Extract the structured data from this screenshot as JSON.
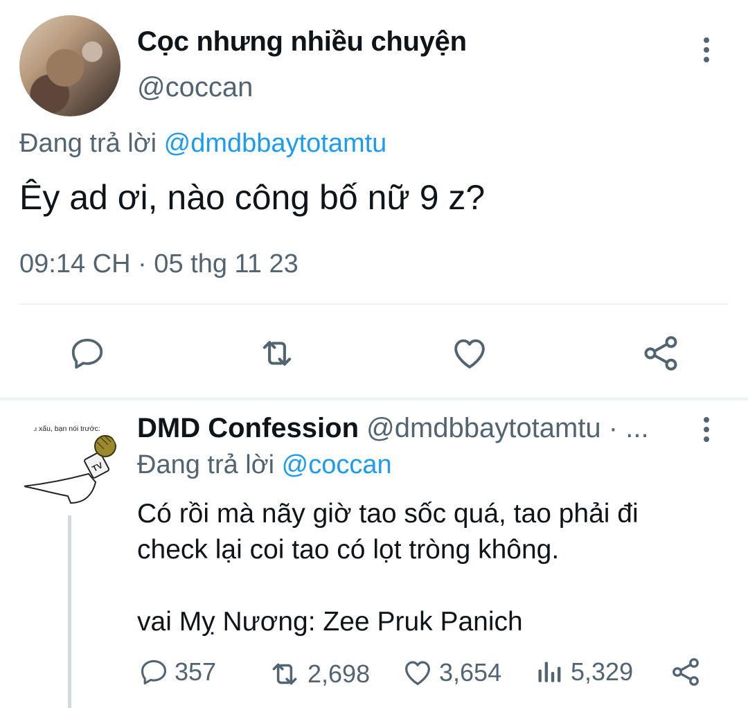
{
  "main_tweet": {
    "display_name": "Cọc nhưng nhiều chuyện",
    "handle": "@coccan",
    "reply_prefix": "Đang trả lời",
    "reply_to": "@dmdbbaytotamtu",
    "text": "Êy ad ơi, nào công bố nữ 9 z?",
    "timestamp": "09:14 CH · 05 thg 11 23",
    "actions": [
      "reply-icon",
      "retweet-icon",
      "like-icon",
      "share-icon"
    ]
  },
  "reply_tweet": {
    "avatar_caption": "...i xấu, bạn nói trước:",
    "avatar_mic_label": "TV",
    "display_name": "DMD Confession",
    "handle_meta": "@dmdbbaytotamtu · ...",
    "reply_prefix": "Đang trả lời",
    "reply_to": "@coccan",
    "text_line1": "Có rồi mà nãy giờ tao sốc quá, tao phải đi",
    "text_line2": "check lại coi tao có lọt tròng không.",
    "text_line3": "vai Mỵ Nương: Zee Pruk Panich",
    "metrics": {
      "replies": "357",
      "retweets": "2,698",
      "likes": "3,654",
      "views": "5,329"
    }
  },
  "colors": {
    "text": "#0f1419",
    "muted": "#536471",
    "link": "#1d9bf0",
    "divider": "#eff3f4"
  }
}
